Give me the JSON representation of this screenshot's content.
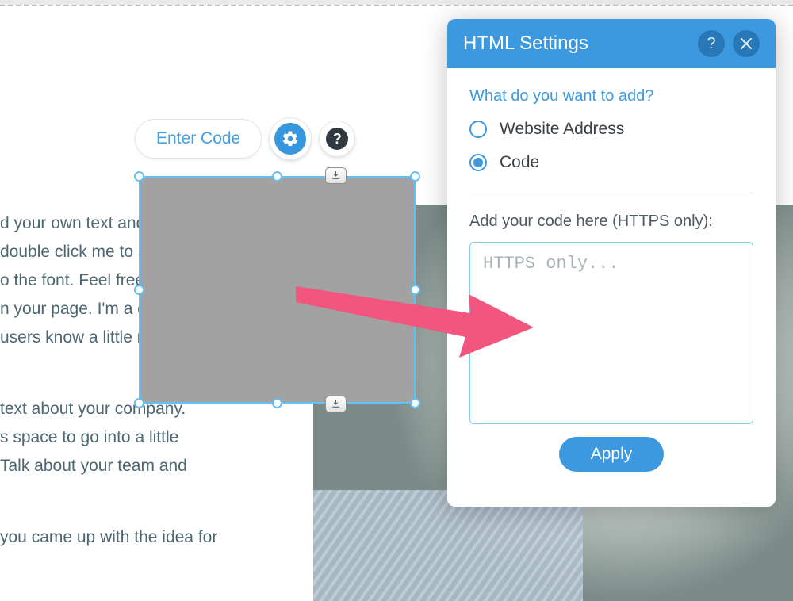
{
  "bg_text": {
    "l1": "d your own text and edit me.",
    "l2": "double click me to add your",
    "l3": "o the font. Feel free to drag",
    "l4": "n your page. I'm a great",
    "l5": "users know a little more",
    "l6": " text about your company.",
    "l7": "s space to go into a little",
    "l8": " Talk about your team and",
    "l9": "you came up with the idea for"
  },
  "toolbar": {
    "enter_code_label": "Enter Code"
  },
  "panel": {
    "title": "HTML Settings",
    "section_label": "What do you want to add?",
    "option_website": "Website Address",
    "option_code": "Code",
    "selected": "code",
    "code_label": "Add your code here (HTTPS only):",
    "code_placeholder": "HTTPS only...",
    "code_value": "",
    "apply_label": "Apply"
  },
  "colors": {
    "accent": "#3c99e0",
    "accent_dark": "#2878b8",
    "selection": "#66bff2",
    "arrow": "#f2557e"
  }
}
